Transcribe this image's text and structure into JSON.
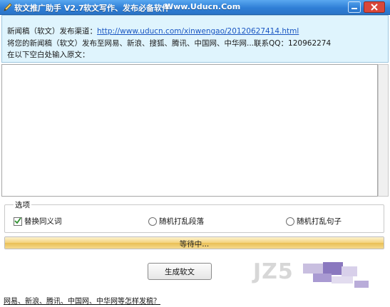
{
  "window": {
    "app_title": "软文推广助手 V2.7",
    "slogan": "软文写作、发布必备软件",
    "website": "Www.Uducn.Com"
  },
  "info": {
    "line1_prefix": "新闻稿（软文）发布渠道：",
    "line1_link": "http://www.uducn.com/xinwengao/20120627414.html",
    "line2": "将您的新闻稿（软文）发布至网易、新浪、搜狐、腾讯、中国网、中华网...联系QQ：120962274",
    "line3": "在以下空白处输入原文："
  },
  "editor": {
    "value": ""
  },
  "options": {
    "legend": "选项",
    "items": [
      {
        "label": "替换同义词",
        "type": "checkbox",
        "checked": true
      },
      {
        "label": "随机打乱段落",
        "type": "radio",
        "checked": false
      },
      {
        "label": "随机打乱句子",
        "type": "radio",
        "checked": false
      }
    ]
  },
  "progress": {
    "text": "等待中...",
    "value": 1.0
  },
  "actions": {
    "generate_label": "生成软文"
  },
  "footer": {
    "link_text": "网易、新浪、腾讯、中国网、中华网等怎样发稿？"
  },
  "watermark": {
    "text": "JZ5"
  },
  "colors": {
    "titlebar": "#2f7fd6",
    "info_bg": "#dff4fd",
    "link": "#1a56c2",
    "progress_fill": "#f3d27a"
  }
}
